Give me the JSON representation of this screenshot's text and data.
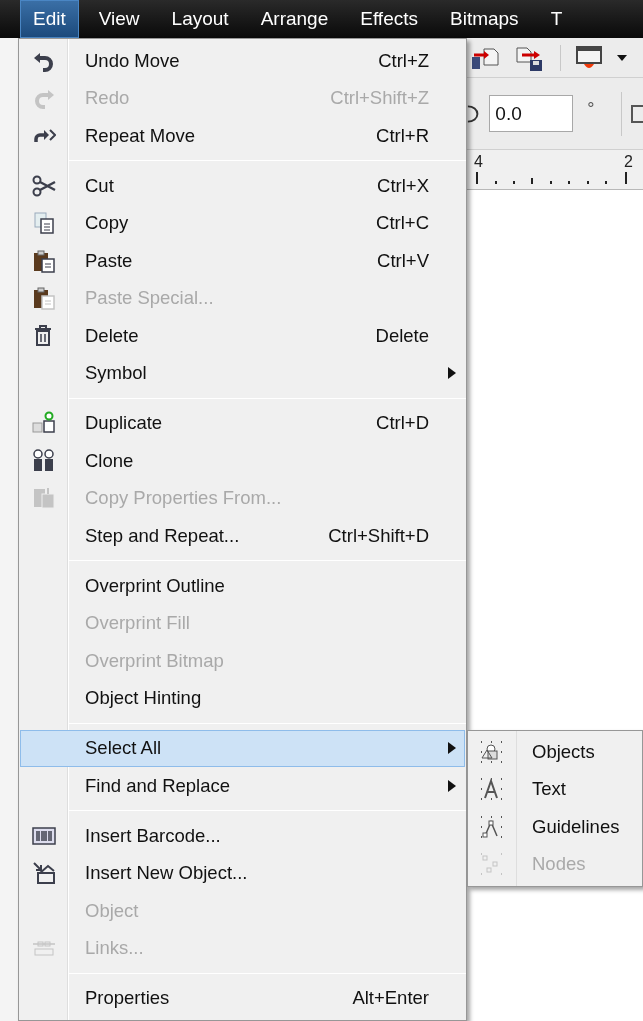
{
  "menubar": [
    {
      "label": "Edit",
      "selected": true
    },
    {
      "label": "View",
      "selected": false
    },
    {
      "label": "Layout",
      "selected": false
    },
    {
      "label": "Arrange",
      "selected": false
    },
    {
      "label": "Effects",
      "selected": false
    },
    {
      "label": "Bitmaps",
      "selected": false
    },
    {
      "label": "T",
      "selected": false
    }
  ],
  "toolbar": {
    "angle_field": {
      "value": "0.0"
    },
    "unit": "°"
  },
  "ruler": {
    "labels": [
      "4",
      "2"
    ]
  },
  "menu": {
    "items": [
      {
        "kind": "item",
        "label": "Undo Move",
        "shortcut": "Ctrl+Z",
        "disabled": false,
        "selected": false
      },
      {
        "kind": "item",
        "label": "Redo",
        "shortcut": "Ctrl+Shift+Z",
        "disabled": true,
        "selected": false
      },
      {
        "kind": "item",
        "label": "Repeat Move",
        "shortcut": "Ctrl+R",
        "disabled": false,
        "selected": false
      },
      {
        "kind": "separator"
      },
      {
        "kind": "item",
        "label": "Cut",
        "shortcut": "Ctrl+X",
        "disabled": false,
        "selected": false
      },
      {
        "kind": "item",
        "label": "Copy",
        "shortcut": "Ctrl+C",
        "disabled": false,
        "selected": false
      },
      {
        "kind": "item",
        "label": "Paste",
        "shortcut": "Ctrl+V",
        "disabled": false,
        "selected": false
      },
      {
        "kind": "item",
        "label": "Paste Special...",
        "disabled": true,
        "selected": false
      },
      {
        "kind": "item",
        "label": "Delete",
        "shortcut": "Delete",
        "disabled": false,
        "selected": false
      },
      {
        "kind": "submenu",
        "label": "Symbol",
        "disabled": false,
        "selected": false
      },
      {
        "kind": "separator"
      },
      {
        "kind": "item",
        "label": "Duplicate",
        "shortcut": "Ctrl+D",
        "disabled": false,
        "selected": false
      },
      {
        "kind": "item",
        "label": "Clone",
        "disabled": false,
        "selected": false
      },
      {
        "kind": "item",
        "label": "Copy Properties From...",
        "disabled": true,
        "selected": false
      },
      {
        "kind": "item",
        "label": "Step and Repeat...",
        "shortcut": "Ctrl+Shift+D",
        "disabled": false,
        "selected": false
      },
      {
        "kind": "separator"
      },
      {
        "kind": "item",
        "label": "Overprint Outline",
        "disabled": false,
        "selected": false
      },
      {
        "kind": "item",
        "label": "Overprint Fill",
        "disabled": true,
        "selected": false
      },
      {
        "kind": "item",
        "label": "Overprint Bitmap",
        "disabled": true,
        "selected": false
      },
      {
        "kind": "item",
        "label": "Object Hinting",
        "disabled": false,
        "selected": false
      },
      {
        "kind": "separator"
      },
      {
        "kind": "submenu",
        "label": "Select All",
        "disabled": false,
        "selected": true
      },
      {
        "kind": "submenu",
        "label": "Find and Replace",
        "disabled": false,
        "selected": false
      },
      {
        "kind": "separator"
      },
      {
        "kind": "item",
        "label": "Insert Barcode...",
        "disabled": false,
        "selected": false
      },
      {
        "kind": "item",
        "label": "Insert New Object...",
        "disabled": false,
        "selected": false
      },
      {
        "kind": "item",
        "label": "Object",
        "disabled": true,
        "selected": false
      },
      {
        "kind": "item",
        "label": "Links...",
        "disabled": true,
        "selected": false
      },
      {
        "kind": "separator"
      },
      {
        "kind": "item",
        "label": "Properties",
        "shortcut": "Alt+Enter",
        "disabled": false,
        "selected": false
      }
    ]
  },
  "submenu": {
    "items": [
      {
        "label": "Objects",
        "disabled": false
      },
      {
        "label": "Text",
        "disabled": false
      },
      {
        "label": "Guidelines",
        "disabled": false
      },
      {
        "label": "Nodes",
        "disabled": true
      }
    ]
  }
}
